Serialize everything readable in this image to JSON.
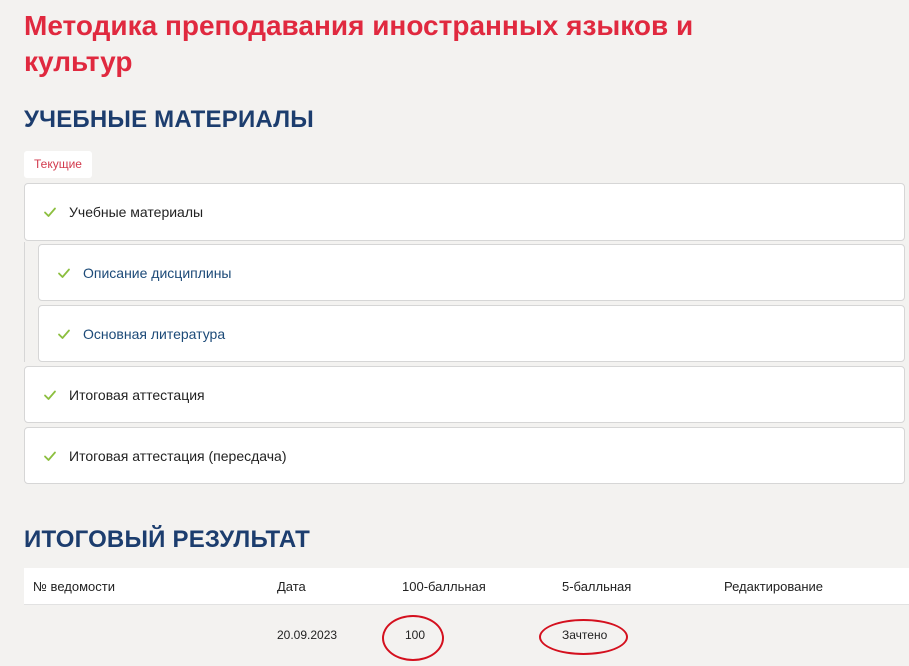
{
  "course": {
    "title": "Методика преподавания иностранных языков и культур"
  },
  "materials": {
    "section_title": "УЧЕБНЫЕ МАТЕРИАЛЫ",
    "tab_current": "Текущие",
    "items": [
      {
        "label": "Учебные материалы",
        "checked": true
      },
      {
        "label": "Описание дисциплины",
        "checked": true
      },
      {
        "label": "Основная литература",
        "checked": true
      },
      {
        "label": "Итоговая аттестация",
        "checked": true
      },
      {
        "label": "Итоговая аттестация (пересдача)",
        "checked": true
      }
    ]
  },
  "result": {
    "section_title": "ИТОГОВЫЙ РЕЗУЛЬТАТ",
    "columns": [
      "№ ведомости",
      "Дата",
      "100-балльная",
      "5-балльная",
      "Редактирование"
    ],
    "rows": [
      {
        "statement_no": "",
        "date": "20.09.2023",
        "score_100": "100",
        "score_5": "Зачтено",
        "edit": ""
      }
    ]
  },
  "colors": {
    "title": "#e0293f",
    "heading": "#1c3d6e",
    "check": "#8cbf3f",
    "annotation": "#d4101e"
  },
  "icons": {
    "check": "check-icon"
  }
}
